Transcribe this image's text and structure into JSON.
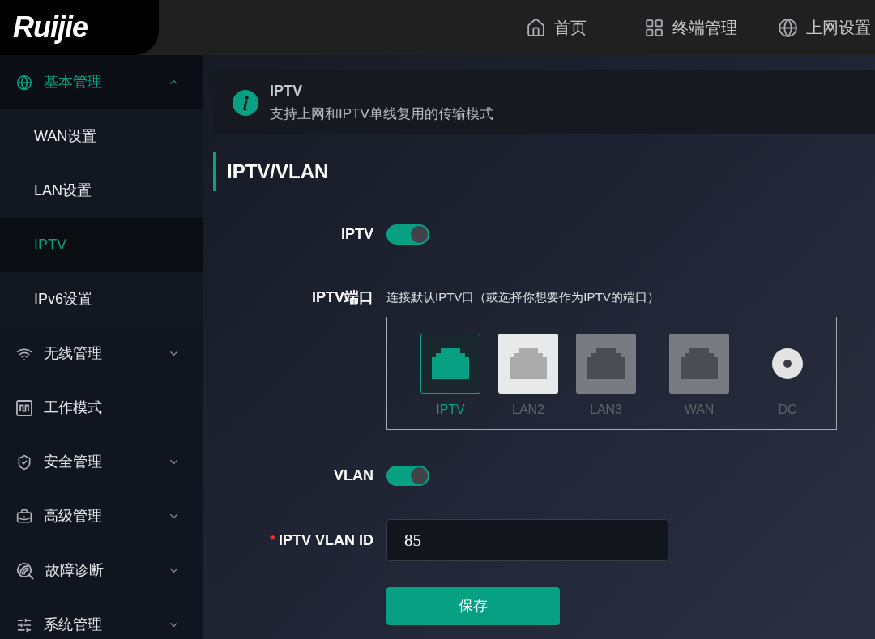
{
  "header": {
    "logo": "Ruijie",
    "nav": [
      {
        "label": "首页"
      },
      {
        "label": "终端管理"
      },
      {
        "label": "上网设置"
      }
    ]
  },
  "sidebar": {
    "items": [
      {
        "label": "基本管理",
        "selected": true,
        "expanded": true,
        "children": [
          {
            "label": "WAN设置",
            "selected": false
          },
          {
            "label": "LAN设置",
            "selected": false
          },
          {
            "label": "IPTV",
            "selected": true
          },
          {
            "label": "IPv6设置",
            "selected": false
          }
        ]
      },
      {
        "label": "无线管理",
        "selected": false,
        "expanded": false
      },
      {
        "label": "工作模式",
        "selected": false
      },
      {
        "label": "安全管理",
        "selected": false,
        "expanded": false
      },
      {
        "label": "高级管理",
        "selected": false,
        "expanded": false
      },
      {
        "label": "故障诊断",
        "selected": false,
        "expanded": false
      },
      {
        "label": "系统管理",
        "selected": false,
        "expanded": false
      }
    ]
  },
  "notice": {
    "title": "IPTV",
    "text": "支持上网和IPTV单线复用的传输模式"
  },
  "section": {
    "title": "IPTV/VLAN"
  },
  "form": {
    "fields": [
      {
        "kind": "switch",
        "label": "IPTV",
        "on": true
      },
      {
        "kind": "ports",
        "label": "IPTV端口",
        "hint": "连接默认IPTV口（或选择你想要作为IPTV的端口）",
        "ports": [
          {
            "kind": "rj45",
            "label": "IPTV",
            "selected": true,
            "connected": true
          },
          {
            "kind": "rj45",
            "label": "LAN2",
            "selected": false,
            "connected": true
          },
          {
            "kind": "rj45",
            "label": "LAN3",
            "selected": false,
            "connected": false
          },
          {
            "kind": "rj45",
            "label": "WAN",
            "selected": false,
            "connected": false
          },
          {
            "kind": "dc",
            "label": "DC",
            "selected": false,
            "connected": true
          }
        ]
      },
      {
        "kind": "switch",
        "label": "VLAN",
        "on": true
      },
      {
        "kind": "input",
        "label": "IPTV VLAN ID",
        "required_mark": "*",
        "value": "85"
      }
    ],
    "submit": "保存"
  }
}
